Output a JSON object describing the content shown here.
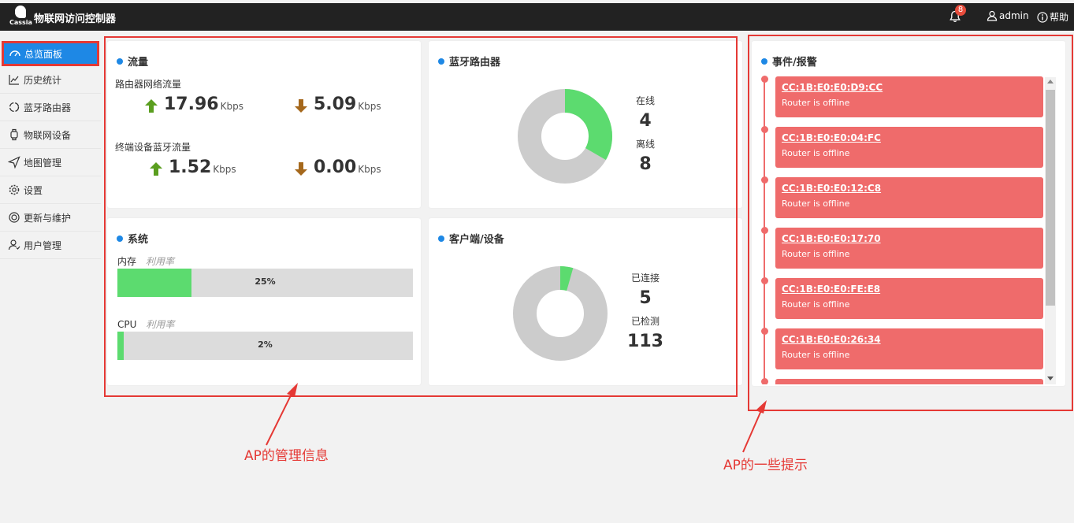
{
  "header": {
    "logo_text": "Cassia",
    "title": "物联网访问控制器",
    "notification_count": "8",
    "user": "admin",
    "help": "帮助"
  },
  "sidebar": {
    "items": [
      {
        "label": "总览面板",
        "icon": "dashboard-icon"
      },
      {
        "label": "历史统计",
        "icon": "chart-line-icon"
      },
      {
        "label": "蓝牙路由器",
        "icon": "router-icon"
      },
      {
        "label": "物联网设备",
        "icon": "watch-icon"
      },
      {
        "label": "地图管理",
        "icon": "send-icon"
      },
      {
        "label": "设置",
        "icon": "gear-icon"
      },
      {
        "label": "更新与维护",
        "icon": "refresh-icon"
      },
      {
        "label": "用户管理",
        "icon": "users-icon"
      }
    ]
  },
  "traffic": {
    "title": "流量",
    "router_label": "路由器网络流量",
    "router_up": "17.96",
    "router_down": "5.09",
    "device_label": "终端设备蓝牙流量",
    "device_up": "1.52",
    "device_down": "0.00",
    "unit": "Kbps"
  },
  "routers": {
    "title": "蓝牙路由器",
    "online_label": "在线",
    "online": "4",
    "offline_label": "离线",
    "offline": "8",
    "online_fraction": 0.333
  },
  "system": {
    "title": "系统",
    "memory_label": "内存",
    "usage_label": "利用率",
    "memory_pct": "25%",
    "memory_value": 0.25,
    "cpu_label": "CPU",
    "cpu_pct": "2%",
    "cpu_value": 0.02
  },
  "clients": {
    "title": "客户端/设备",
    "connected_label": "已连接",
    "connected": "5",
    "detected_label": "已检测",
    "detected": "113",
    "connected_fraction": 0.044
  },
  "events": {
    "title": "事件/报警",
    "items": [
      {
        "mac": "CC:1B:E0:E0:D9:CC",
        "msg": "Router is offline"
      },
      {
        "mac": "CC:1B:E0:E0:04:FC",
        "msg": "Router is offline"
      },
      {
        "mac": "CC:1B:E0:E0:12:C8",
        "msg": "Router is offline"
      },
      {
        "mac": "CC:1B:E0:E0:17:70",
        "msg": "Router is offline"
      },
      {
        "mac": "CC:1B:E0:E0:FE:E8",
        "msg": "Router is offline"
      },
      {
        "mac": "CC:1B:E0:E0:26:34",
        "msg": "Router is offline"
      }
    ]
  },
  "annotations": {
    "left": "AP的管理信息",
    "right": "AP的一些提示"
  },
  "colors": {
    "accent": "#1e88e5",
    "green": "#5cdb6f",
    "donut_gray": "#cccccc",
    "alert_red": "#ef6b6b",
    "annotation_red": "#e53935"
  }
}
